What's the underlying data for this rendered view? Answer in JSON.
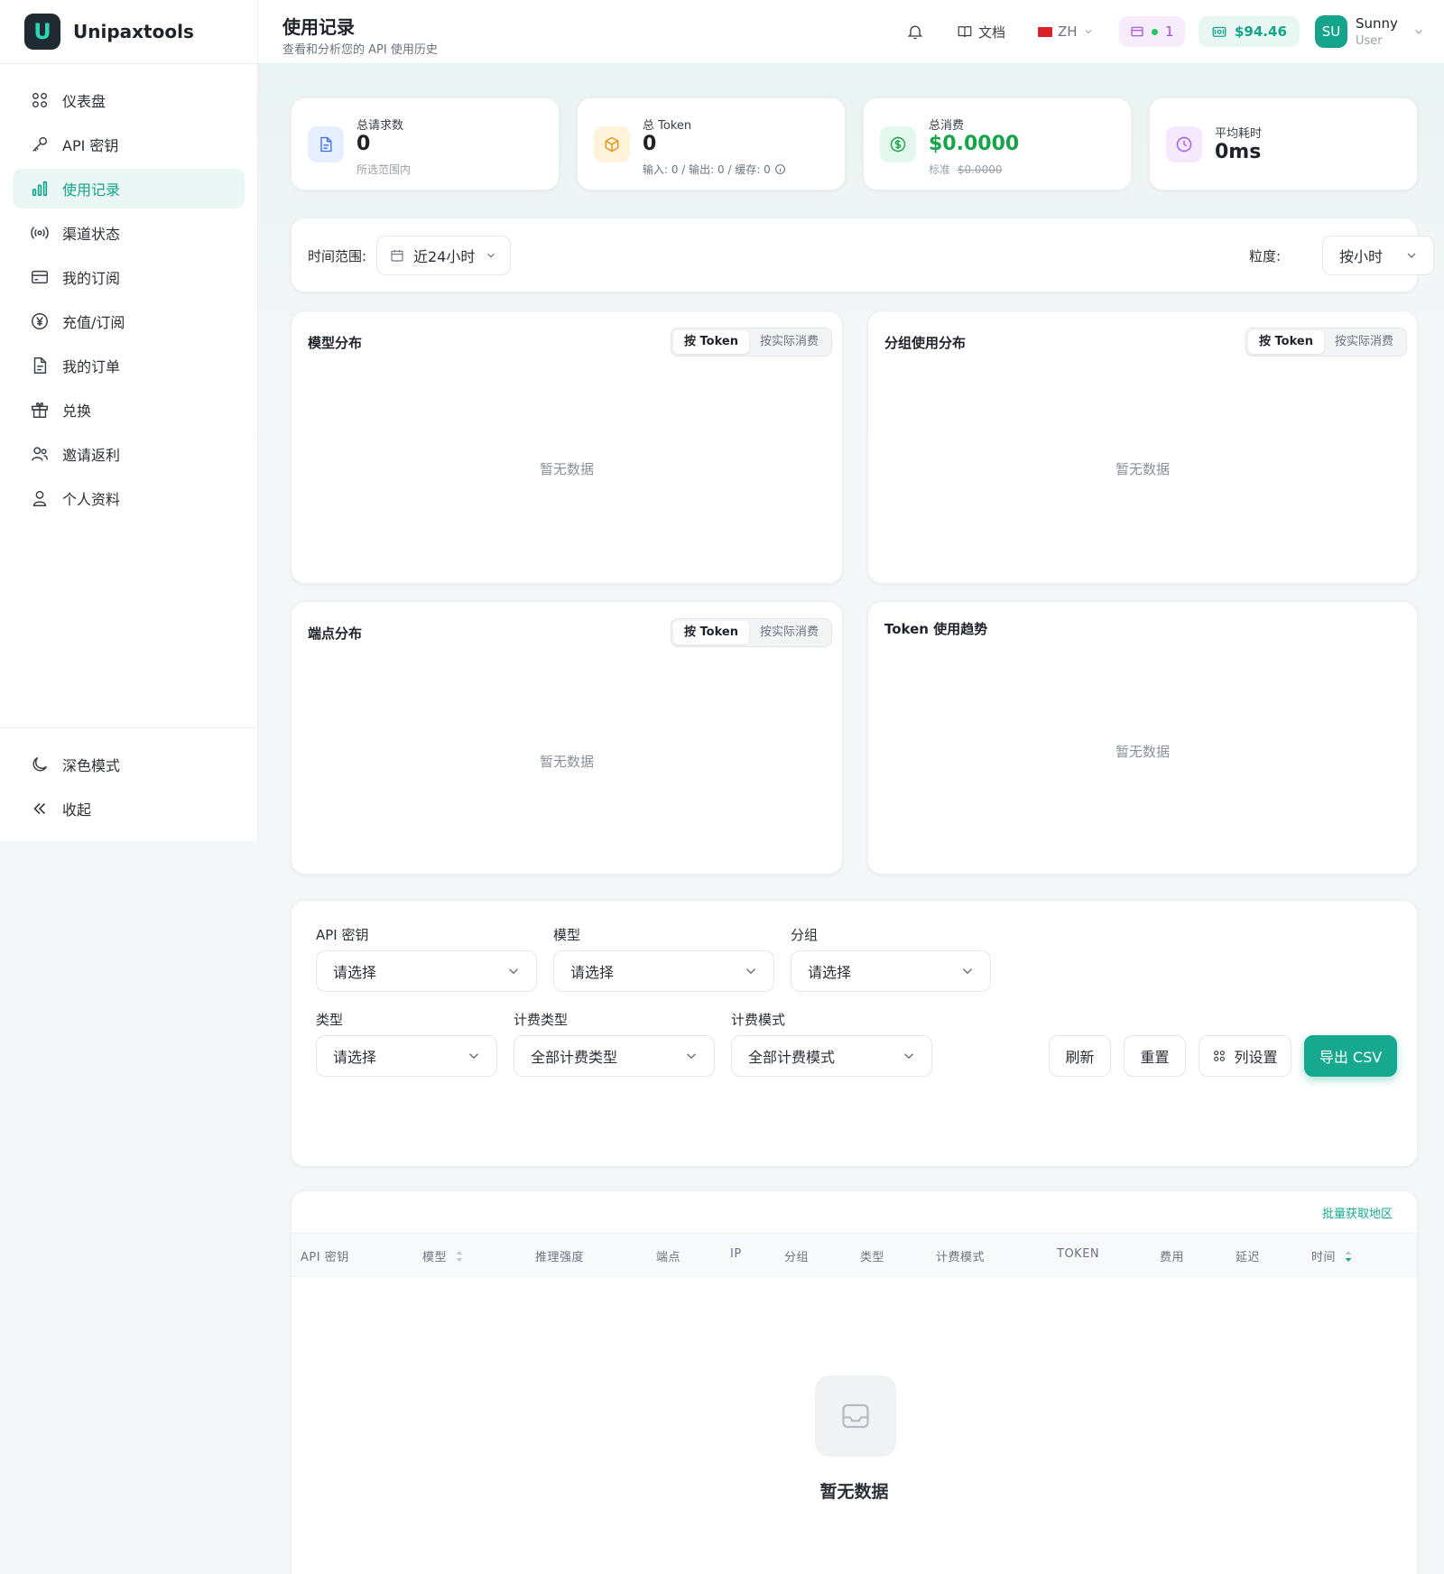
{
  "brand": {
    "name": "Unipaxtools",
    "logo_letter": "U"
  },
  "sidebar": {
    "items": [
      {
        "label": "仪表盘",
        "icon": "grid-icon"
      },
      {
        "label": "API 密钥",
        "icon": "key-icon"
      },
      {
        "label": "使用记录",
        "icon": "bar-chart-icon",
        "active": true
      },
      {
        "label": "渠道状态",
        "icon": "signal-icon"
      },
      {
        "label": "我的订阅",
        "icon": "card-icon"
      },
      {
        "label": "充值/订阅",
        "icon": "yen-icon"
      },
      {
        "label": "我的订单",
        "icon": "file-icon"
      },
      {
        "label": "兑换",
        "icon": "gift-icon"
      },
      {
        "label": "邀请返利",
        "icon": "users-icon"
      },
      {
        "label": "个人资料",
        "icon": "user-icon"
      }
    ],
    "dark_mode": "深色模式",
    "collapse": "收起"
  },
  "header": {
    "title": "使用记录",
    "subtitle": "查看和分析您的 API 使用历史",
    "docs": "文档",
    "lang": "ZH",
    "subscription_count": "1",
    "balance": "$94.46",
    "avatar_initials": "SU",
    "user_name": "Sunny",
    "user_role": "User"
  },
  "stats": {
    "requests": {
      "label": "总请求数",
      "value": "0",
      "sub": "所选范围内"
    },
    "tokens": {
      "label": "总 Token",
      "value": "0",
      "sub": "输入: 0 / 输出: 0 / 缓存: 0"
    },
    "cost": {
      "label": "总消费",
      "value": "$0.0000",
      "sub_prefix": "标准",
      "sub_value": "$0.0000"
    },
    "latency": {
      "label": "平均耗时",
      "value": "0ms"
    }
  },
  "range": {
    "label": "时间范围:",
    "value": "近24小时",
    "granularity_label": "粒度:",
    "granularity_value": "按小时"
  },
  "charts": {
    "toggle_token": "按 Token",
    "toggle_cost": "按实际消费",
    "empty": "暂无数据",
    "model": "模型分布",
    "group": "分组使用分布",
    "endpoint": "端点分布",
    "trend": "Token 使用趋势"
  },
  "filters": {
    "api_key": {
      "label": "API 密钥",
      "value": "请选择"
    },
    "model": {
      "label": "模型",
      "value": "请选择"
    },
    "group": {
      "label": "分组",
      "value": "请选择"
    },
    "type": {
      "label": "类型",
      "value": "请选择"
    },
    "billing_type": {
      "label": "计费类型",
      "value": "全部计费类型"
    },
    "billing_mode": {
      "label": "计费模式",
      "value": "全部计费模式"
    },
    "refresh": "刷新",
    "reset": "重置",
    "columns": "列设置",
    "export": "导出 CSV"
  },
  "table": {
    "batch_region": "批量获取地区",
    "columns": [
      "API 密钥",
      "模型",
      "推理强度",
      "端点",
      "IP",
      "分组",
      "类型",
      "计费模式",
      "TOKEN",
      "费用",
      "延迟",
      "时间"
    ],
    "empty": "暂无数据"
  },
  "colors": {
    "accent": "#17a98f",
    "purple": "#9c4fd6",
    "green": "#14a38b"
  }
}
